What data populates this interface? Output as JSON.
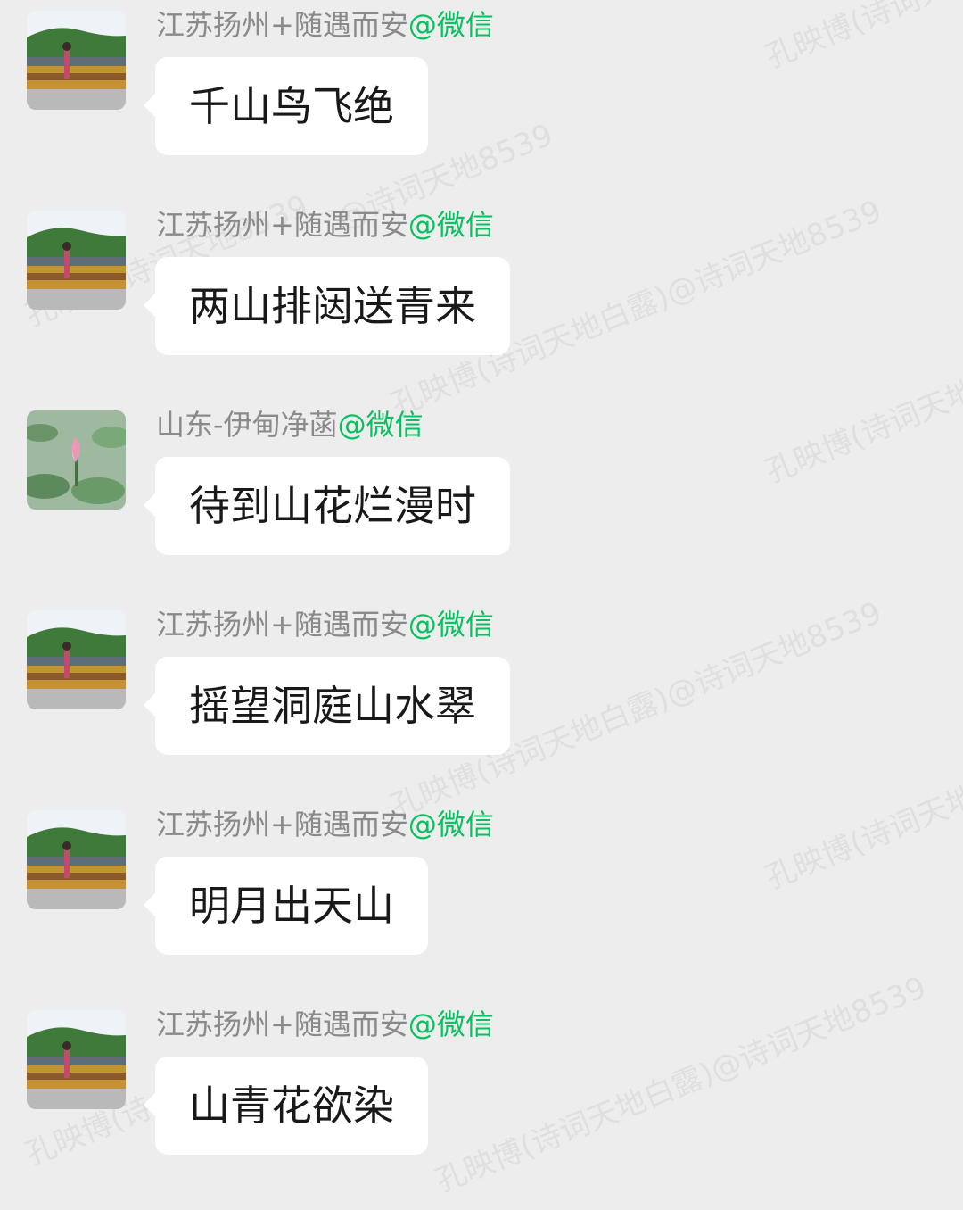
{
  "watermarks": [
    "孔映博(诗词天",
    "@诗词天地8539",
    "孔映博(诗词天地白露)@诗词天地8539",
    "孔映博(诗词天地",
    "孔映博(诗词天地8539",
    "孔映博(诗词天地白露)@诗词天地8539",
    "孔映博(诗词天地",
    "孔映博(诗",
    "孔映博(诗词天地白露)@诗词天地8539"
  ],
  "messages": [
    {
      "sender": "江苏扬州+随遇而安",
      "source": "@微信",
      "text": "千山鸟飞绝",
      "avatar": "landscape-avatar"
    },
    {
      "sender": "江苏扬州+随遇而安",
      "source": "@微信",
      "text": "两山排闼送青来",
      "avatar": "landscape-avatar"
    },
    {
      "sender": "山东-伊甸净菡",
      "source": "@微信",
      "text": "待到山花烂漫时",
      "avatar": "lotus-avatar"
    },
    {
      "sender": "江苏扬州+随遇而安",
      "source": "@微信",
      "text": "摇望洞庭山水翠",
      "avatar": "landscape-avatar"
    },
    {
      "sender": "江苏扬州+随遇而安",
      "source": "@微信",
      "text": "明月出天山",
      "avatar": "landscape-avatar"
    },
    {
      "sender": "江苏扬州+随遇而安",
      "source": "@微信",
      "text": "山青花欲染",
      "avatar": "landscape-avatar"
    }
  ],
  "colors": {
    "background": "#ededed",
    "bubble": "#ffffff",
    "sender_text": "#8a8a8a",
    "source_green": "#07c160"
  }
}
